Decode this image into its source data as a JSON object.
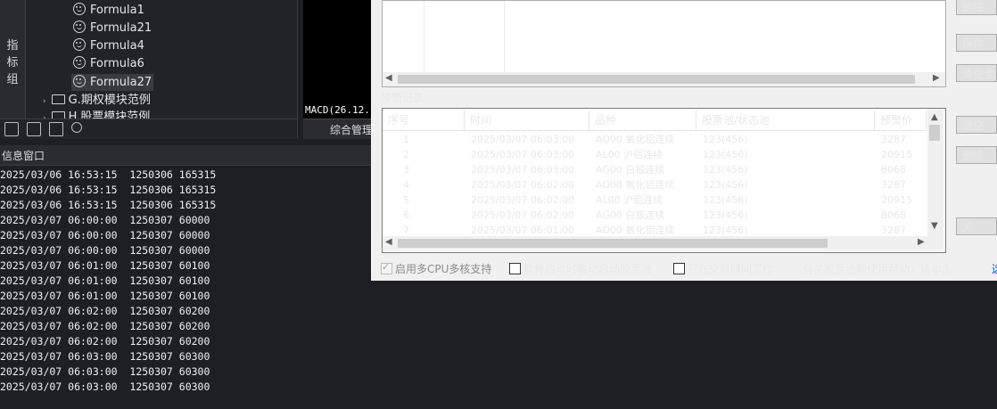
{
  "tree": {
    "vertical_tab": [
      "指",
      "标",
      "组"
    ],
    "items": [
      "Formula1",
      "Formula21",
      "Formula4",
      "Formula6",
      "Formula27"
    ],
    "folders": [
      "G.期权模块范例",
      "H.股票模块范例"
    ]
  },
  "chart": {
    "macd_label": "MACD(26.12.",
    "manage_tab": "综合管理"
  },
  "info_window": {
    "title": "信息窗口",
    "lines": [
      "2025/03/06 16:53:15  1250306 165315",
      "2025/03/06 16:53:15  1250306 165315",
      "2025/03/06 16:53:15  1250306 165315",
      "2025/03/07 06:00:00  1250307 60000",
      "2025/03/07 06:00:00  1250307 60000",
      "2025/03/07 06:00:00  1250307 60000",
      "2025/03/07 06:01:00  1250307 60100",
      "2025/03/07 06:01:00  1250307 60100",
      "2025/03/07 06:01:00  1250307 60100",
      "2025/03/07 06:02:00  1250307 60200",
      "2025/03/07 06:02:00  1250307 60200",
      "2025/03/07 06:02:00  1250307 60200",
      "2025/03/07 06:03:00  1250307 60300",
      "2025/03/07 06:03:00  1250307 60300",
      "2025/03/07 06:03:00  1250307 60300"
    ]
  },
  "dialog": {
    "alert_label": "预警记录:",
    "columns": [
      "序号",
      "时间",
      "品种",
      "股票池/状态池",
      "预警价"
    ],
    "rows": [
      [
        "1",
        "2025/03/07 06:03:00",
        "AO00 氧化铝连续",
        "123(456)",
        "3287"
      ],
      [
        "2",
        "2025/03/07 06:03:00",
        "AL00 沪铝连续",
        "123(456)",
        "20915"
      ],
      [
        "3",
        "2025/03/07 06:03:00",
        "AG00 白银连续",
        "123(456)",
        "8068"
      ],
      [
        "4",
        "2025/03/07 06:02:00",
        "AO00 氧化铝连续",
        "123(456)",
        "3287"
      ],
      [
        "5",
        "2025/03/07 06:02:00",
        "AL00 沪铝连续",
        "123(456)",
        "20915"
      ],
      [
        "6",
        "2025/03/07 06:02:00",
        "AG00 白银连续",
        "123(456)",
        "8068"
      ],
      [
        "7",
        "2025/03/07 06:01:00",
        "AO00 氧化铝连续",
        "123(456)",
        "3287"
      ]
    ],
    "buttons": [
      "删除",
      "保存",
      "清空全部",
      "清空",
      "删除",
      "关"
    ],
    "checkboxes": [
      "启用多CPU多核支持",
      "软件启动时自动启动股票池",
      "只在交易时间工作"
    ],
    "help_text": "有关股票池的使用帮助，请单击",
    "help_link": "这"
  }
}
